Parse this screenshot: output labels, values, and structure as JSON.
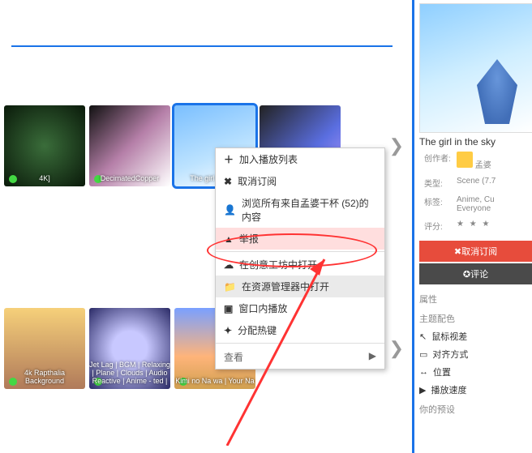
{
  "toolbar": {
    "tools_icon": "tools-icon",
    "monitor_icon": "monitor-icon",
    "gear_icon": "gear-icon"
  },
  "thumbs_row1": [
    {
      "caption": "4K]"
    },
    {
      "caption": "DecimatedCopper"
    },
    {
      "caption": "The girl in the s"
    },
    {
      "caption": ""
    }
  ],
  "thumbs_row2": [
    {
      "caption": "4k Rapthalia Background"
    },
    {
      "caption": "Jet Lag | BGM | Relaxing | Plane | Clouds | Audio Reactive | Anime - ted |"
    },
    {
      "caption": "Kimi no Na wa | Your Na"
    }
  ],
  "context_menu": {
    "add": "加入播放列表",
    "unsub": "取消订阅",
    "browse": "浏览所有来自孟婆干杯 (52)的内容",
    "report": "举报",
    "workshop": "在创意工坊中打开",
    "resmgr": "在资源管理器中打开",
    "window": "窗口内播放",
    "hotkey": "分配热键",
    "look": "查看",
    "arrow": "▶"
  },
  "side": {
    "title": "The girl in the sky",
    "meta": {
      "author_k": "创作者:",
      "author_v": "孟婆",
      "type_k": "类型:",
      "type_v": "Scene (7.7",
      "tags_k": "标签:",
      "tags_v": "Anime, Cu\nEveryone",
      "rating_k": "评分:"
    },
    "btn_unsub": "✖取消订阅",
    "btn_comment": "✪评论",
    "props_h1": "属性",
    "props_h2": "主题配色",
    "p_parallax": "鼠标视差",
    "p_align": "对齐方式",
    "p_pos": "位置",
    "p_speed": "播放速度",
    "p_your": "你的预设"
  }
}
